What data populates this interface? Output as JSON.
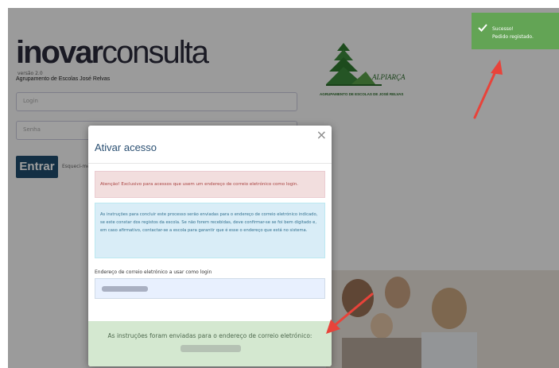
{
  "login": {
    "brand_bold": "inovar",
    "brand_light": "consulta",
    "brand_sub": "versão 2.0",
    "school_name": "Agrupamento de Escolas José Relvas",
    "login_placeholder": "Login",
    "password_placeholder": "Senha",
    "enter_button": "Entrar",
    "forgot_link": "Esqueci-me"
  },
  "school_logo": {
    "name": "ALPIARÇA",
    "subtitle": "AGRUPAMENTO DE ESCOLAS DE JOSÉ RELVAS"
  },
  "toast": {
    "title": "Sucesso!",
    "message": "Pedido registado.",
    "color": "#63a455"
  },
  "modal": {
    "title": "Ativar acesso",
    "close_symbol": "×",
    "warning": "Atenção! Exclusivo para acessos que usem um endereço de correio eletrónico como login.",
    "info": "As instruções para concluir este processo serão enviadas para o endereço de correio eletrónico indicado, se este constar dos registos da escola. Se não forem recebidas, deve confirmar-se se foi bem digitado e, em caso afirmativo, contactar-se a escola para garantir que é esse o endereço que está no sistema.",
    "email_label": "Endereço de correio eletrónico a usar como login",
    "success_message": "As instruções foram enviadas para o endereço de correio eletrónico:"
  },
  "colors": {
    "accent": "#2a4f72",
    "button": "#1f4d6e",
    "arrow": "#e8433a"
  }
}
